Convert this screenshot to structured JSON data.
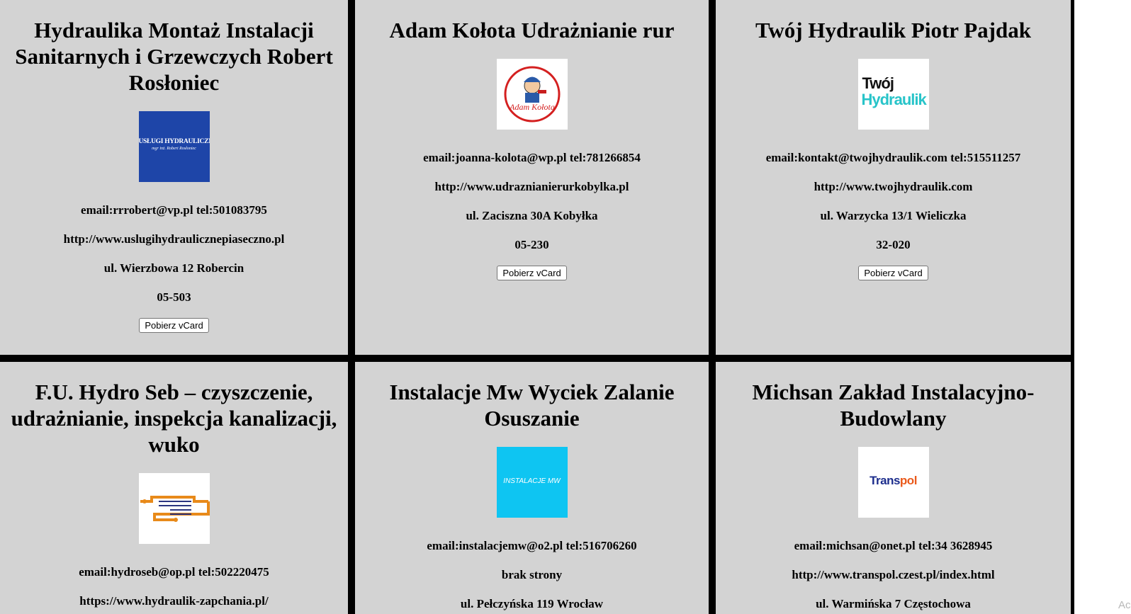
{
  "colors": {
    "card_background": "#d3d3d3",
    "grid_gap": "#000000",
    "logo1_bg": "#1e45a8",
    "logo5_bg": "#0ec5f2"
  },
  "cards": [
    {
      "title": "Hydraulika Montaż Instalacji Sanitarnych i Grzewczych Robert Rosłoniec",
      "logo_text": "USŁUGI HYDRAULICZNE",
      "logo_subtext": "mgr inż. Robert Rosłoniec",
      "contact": "email:rrrobert@vp.pl tel:501083795",
      "website": "http://www.uslugihydraulicznepiaseczno.pl",
      "address": "ul. Wierzbowa 12 Robercin",
      "postal_code": "05-503",
      "button_label": "Pobierz vCard"
    },
    {
      "title": "Adam Kołota Udrażnianie rur",
      "logo_text": "Adam Kołota",
      "contact": "email:joanna-kolota@wp.pl tel:781266854",
      "website": "http://www.udraznianierurkobylka.pl",
      "address": "ul. Zaciszna 30A Kobyłka",
      "postal_code": "05-230",
      "button_label": "Pobierz vCard"
    },
    {
      "title": "Twój Hydraulik Piotr Pajdak",
      "logo_text_1": "Twój",
      "logo_text_2": "Hydraulik",
      "contact": "email:kontakt@twojhydraulik.com tel:515511257",
      "website": "http://www.twojhydraulik.com",
      "address": "ul. Warzycka 13/1 Wieliczka",
      "postal_code": "32-020",
      "button_label": "Pobierz vCard"
    },
    {
      "title": "F.U. Hydro Seb – czyszczenie, udrażnianie, inspekcja kanalizacji, wuko",
      "contact": "email:hydroseb@op.pl tel:502220475",
      "website": "https://www.hydraulik-zapchania.pl/"
    },
    {
      "title": "Instalacje Mw Wyciek Zalanie Osuszanie",
      "logo_text": "INSTALACJE MW",
      "contact": "email:instalacjemw@o2.pl tel:516706260",
      "website": "brak strony",
      "address": "ul. Pełczyńska 119 Wrocław"
    },
    {
      "title": "Michsan Zakład Instalacyjno-Budowlany",
      "logo_text_1": "Trans",
      "logo_text_2": "pol",
      "contact": "email:michsan@onet.pl tel:34 3628945",
      "website": "http://www.transpol.czest.pl/index.html",
      "address": "ul. Warmińska 7 Częstochowa"
    }
  ],
  "corner_text": "Ac"
}
